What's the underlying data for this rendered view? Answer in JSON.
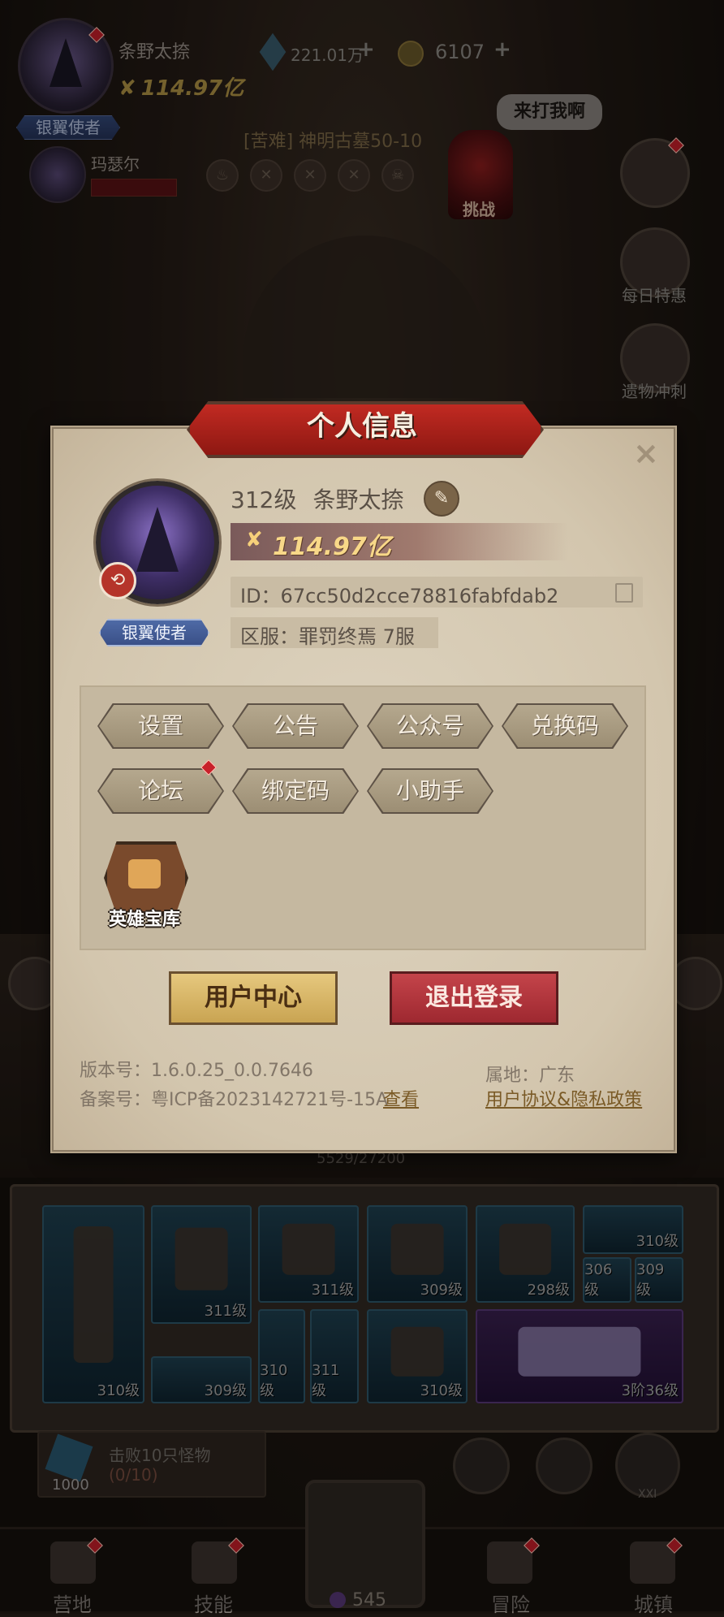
{
  "hud": {
    "player_name": "条野太捺",
    "power": "114.97亿",
    "title_badge": "银翼使者",
    "gems": "221.01万",
    "coins": "6107",
    "plus": "+",
    "ally_name": "玛瑟尔",
    "stage_title": "[苦难] 神明古墓50-10",
    "boss_label": "挑战",
    "boss_speech": "来打我啊"
  },
  "side_buttons": {
    "daily_offer": "每日特惠",
    "relic_rush": "遗物冲刺"
  },
  "modal": {
    "title": "个人信息",
    "close": "×",
    "level": "312级",
    "name": "条野太捺",
    "power": "114.97亿",
    "id_text": "ID：67cc50d2cce78816fabfdab2",
    "server_text": "区服：罪罚终焉 7服",
    "title_badge": "银翼使者",
    "buttons": [
      "设置",
      "公告",
      "公众号",
      "兑换码",
      "论坛",
      "绑定码",
      "小助手"
    ],
    "hero_vault": "英雄宝库",
    "user_center": "用户中心",
    "logout": "退出登录",
    "version": "版本号：1.6.0.25_0.0.7646",
    "icp": "备案号：粤ICP备2023142721号-15A",
    "icp_view": "查看",
    "region": "属地：广东",
    "agreement": "用户协议&隐私政策"
  },
  "game": {
    "xp": "5529/27200",
    "quest_count": "1000",
    "quest_text": "击败10只怪物",
    "quest_progress": "(0/10)",
    "xxi": "XXI",
    "mana": "545"
  },
  "inventory": {
    "slots": [
      "310级",
      "311级",
      "309级",
      "311级",
      "309级",
      "298级",
      "310级",
      "306级",
      "309级",
      "310级",
      "311级",
      "310级",
      "3阶36级"
    ]
  },
  "nav": {
    "camp": "营地",
    "skills": "技能",
    "adventure": "冒险",
    "town": "城镇"
  },
  "colors": {
    "header_red": "#c12a22",
    "parchment": "#d9ceb9",
    "user_center_gold": "#e6c87e",
    "logout_red": "#c4444a"
  }
}
